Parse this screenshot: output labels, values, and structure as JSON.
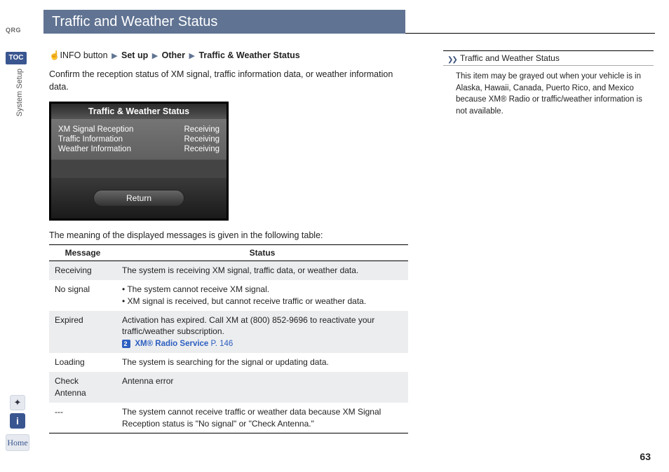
{
  "sidebar": {
    "qrg": "QRG",
    "toc": "TOC",
    "section": "System Setup",
    "voice_icon": "✦",
    "info_icon": "i",
    "home": "Home"
  },
  "header": {
    "title": "Traffic and Weather Status"
  },
  "breadcrumb": {
    "prefix": "INFO button",
    "setup": "Set up",
    "other": "Other",
    "tws": "Traffic & Weather Status"
  },
  "intro": "Confirm the reception status of XM signal, traffic information data, or weather information data.",
  "screen": {
    "title": "Traffic & Weather Status",
    "rows": [
      {
        "label": "XM Signal Reception",
        "val": "Receiving"
      },
      {
        "label": "Traffic Information",
        "val": "Receiving"
      },
      {
        "label": "Weather Information",
        "val": "Receiving"
      }
    ],
    "return": "Return"
  },
  "table_intro": "The meaning of the displayed messages is given in the following table:",
  "table": {
    "h1": "Message",
    "h2": "Status",
    "rows": {
      "receiving_m": "Receiving",
      "receiving_s": "The system is receiving XM signal, traffic data, or weather data.",
      "nosignal_m": "No signal",
      "nosignal_s1": "The system cannot receive XM signal.",
      "nosignal_s2": "XM signal is received, but cannot receive traffic or weather data.",
      "expired_m": "Expired",
      "expired_s": "Activation has expired. Call XM at (800) 852-9696 to reactivate your traffic/weather subscription.",
      "expired_link": "XM® Radio Service",
      "expired_pg": "P. 146",
      "loading_m": "Loading",
      "loading_s": "The system is searching for the signal or updating data.",
      "check_m": "Check Antenna",
      "check_s": "Antenna error",
      "dash_m": "---",
      "dash_s": "The system cannot receive traffic or weather data because XM Signal Reception status is \"No signal\" or \"Check Antenna.\""
    }
  },
  "note": {
    "head": "Traffic and Weather Status",
    "body": "This item may be grayed out when your vehicle is in Alaska, Hawaii, Canada, Puerto Rico, and Mexico because XM® Radio or traffic/weather information is not available."
  },
  "page": "63"
}
